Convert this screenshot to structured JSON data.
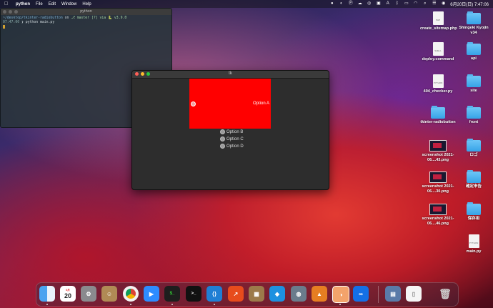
{
  "menubar": {
    "app_name": "python",
    "items": [
      "File",
      "Edit",
      "Window",
      "Help"
    ],
    "datetime": "6月20日(日) 7:47:06"
  },
  "terminal": {
    "title": "python",
    "line1_path": "~/desktop/tkinter-radiobutton",
    "line1_on": " on ",
    "line1_branch": "⎇ master [?] via 🐍 v3.9.0",
    "line2_time": "07:47:00",
    "line2_cmd": " ❯ python main.py"
  },
  "tk_window": {
    "title": "tk",
    "option_a": "Option A",
    "option_b": "Option B",
    "option_c": "Option C",
    "option_d": "Option D",
    "panel_color": "#ff0000"
  },
  "desktop_icons": [
    {
      "label": "create_sitemap.php",
      "kind": "file",
      "tag": "PHP"
    },
    {
      "label": "Shingeki Kyojin v34",
      "kind": "folder"
    },
    {
      "label": "deploy.command",
      "kind": "file",
      "tag": "SHELL"
    },
    {
      "label": "api",
      "kind": "folder"
    },
    {
      "label": "404_checker.py",
      "kind": "file",
      "tag": "PYTHON"
    },
    {
      "label": "site",
      "kind": "folder"
    },
    {
      "label": "tkinter-radiobutton",
      "kind": "folder"
    },
    {
      "label": "front",
      "kind": "folder"
    },
    {
      "label": "screenshot 2021-06....43.png",
      "kind": "shot"
    },
    {
      "label": "ロゴ",
      "kind": "folder"
    },
    {
      "label": "screenshot 2021-06....30.png",
      "kind": "shot"
    },
    {
      "label": "確定申告",
      "kind": "folder"
    },
    {
      "label": "screenshot 2021-06....46.png",
      "kind": "shot"
    },
    {
      "label": "保存用",
      "kind": "folder"
    },
    {
      "label": "main.py",
      "kind": "file",
      "tag": "PYTHON"
    }
  ],
  "dock": {
    "calendar_month": "6月",
    "calendar_day": "20",
    "apps": [
      "finder-icon",
      "calendar-icon",
      "system-preferences-icon",
      "contacts-icon",
      "chrome-icon",
      "zoom-icon",
      "terminal-icon",
      "terminal-alt-icon",
      "vscode-icon",
      "charts-app-icon",
      "archive-icon",
      "docker-icon",
      "preview-icon",
      "app-icon",
      "app-icon-2",
      "infinity-icon",
      "screenshot-folder-icon",
      "document-icon",
      "trash-icon"
    ]
  }
}
